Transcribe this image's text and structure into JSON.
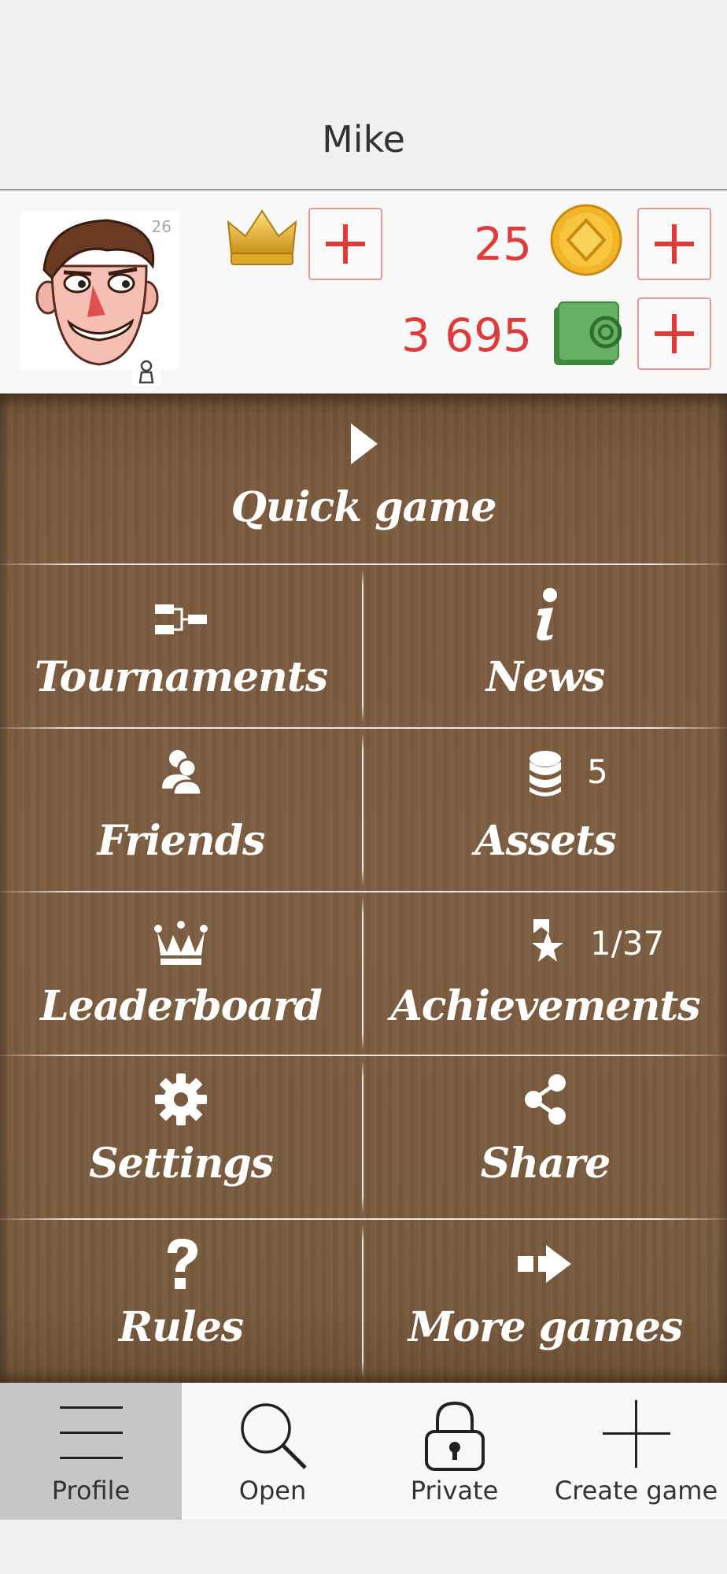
{
  "header": {
    "title": "Mike"
  },
  "profile": {
    "level": "26",
    "coins": "25",
    "cash": "3 695"
  },
  "menu": {
    "quick_game": "Quick game",
    "tournaments": "Tournaments",
    "news": "News",
    "friends": "Friends",
    "assets": "Assets",
    "assets_count": "5",
    "leaderboard": "Leaderboard",
    "achievements": "Achievements",
    "achievements_count": "1/37",
    "settings": "Settings",
    "share": "Share",
    "rules": "Rules",
    "more_games": "More games"
  },
  "tabs": [
    {
      "label": "Profile",
      "icon": "menu-icon",
      "active": true
    },
    {
      "label": "Open",
      "icon": "search-icon",
      "active": false
    },
    {
      "label": "Private",
      "icon": "lock-icon",
      "active": false
    },
    {
      "label": "Create game",
      "icon": "plus-icon",
      "active": false
    }
  ],
  "colors": {
    "accent_red": "#e03a3a",
    "wood": "#7d5d40",
    "active_tab": "#c6c6c6"
  }
}
